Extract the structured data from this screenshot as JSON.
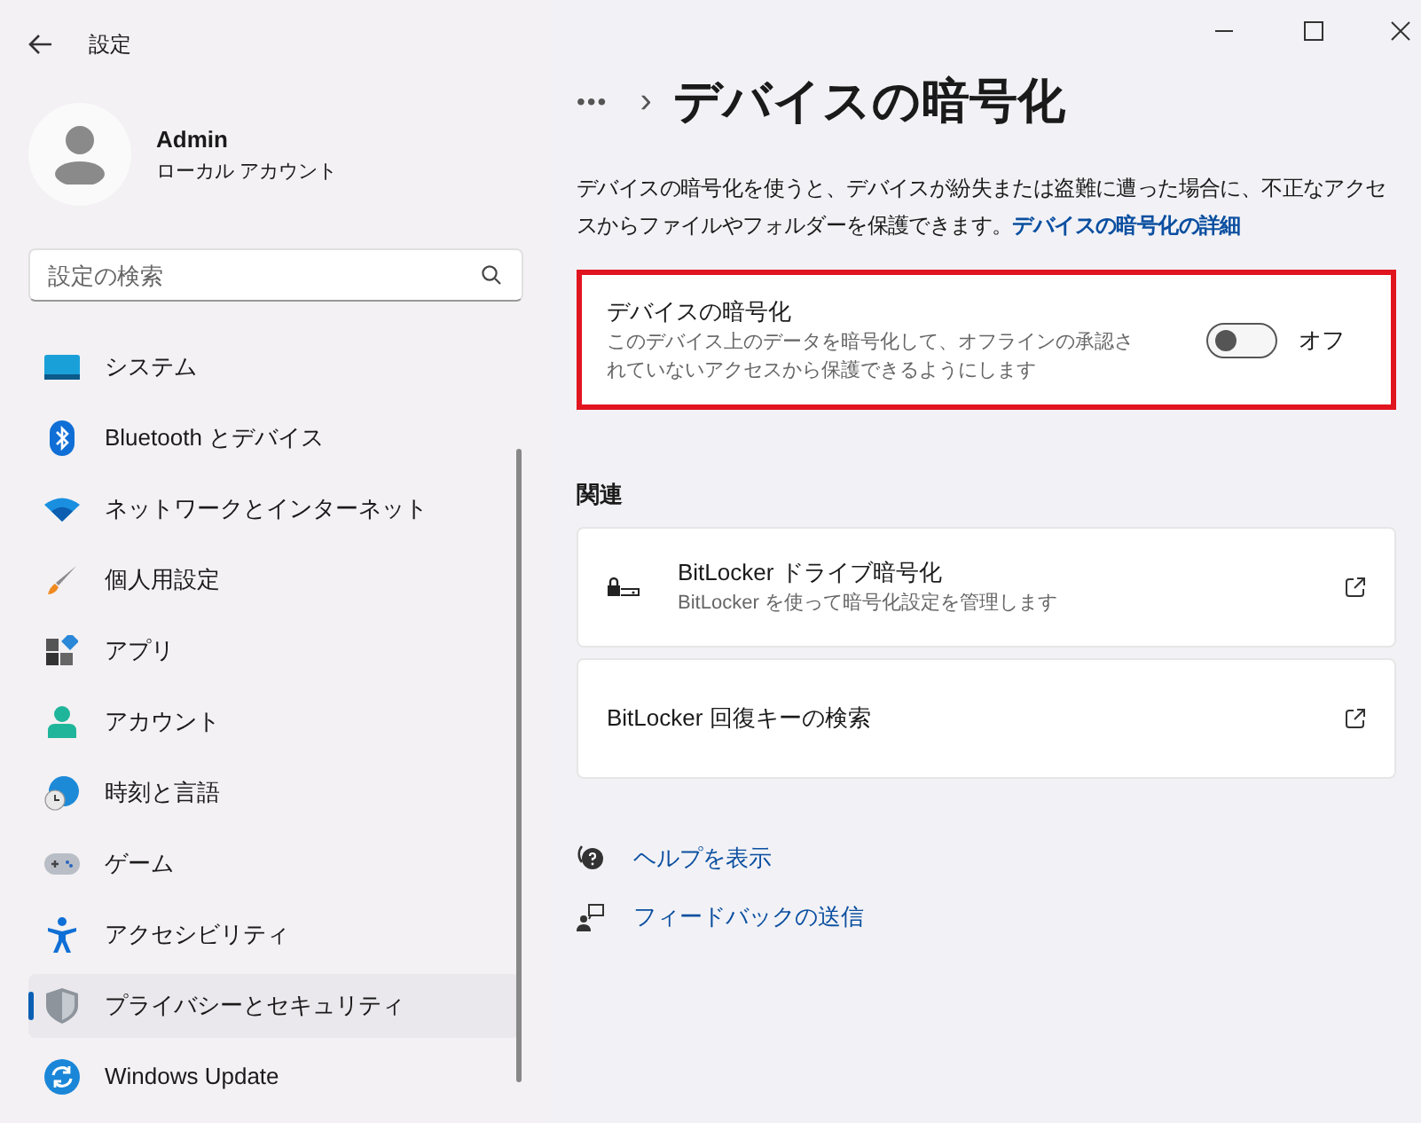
{
  "window": {
    "title": "設定"
  },
  "account": {
    "name": "Admin",
    "type": "ローカル アカウント"
  },
  "search": {
    "placeholder": "設定の検索"
  },
  "sidebar": {
    "items": [
      {
        "label": "システム",
        "selected": false
      },
      {
        "label": "Bluetooth とデバイス",
        "selected": false
      },
      {
        "label": "ネットワークとインターネット",
        "selected": false
      },
      {
        "label": "個人用設定",
        "selected": false
      },
      {
        "label": "アプリ",
        "selected": false
      },
      {
        "label": "アカウント",
        "selected": false
      },
      {
        "label": "時刻と言語",
        "selected": false
      },
      {
        "label": "ゲーム",
        "selected": false
      },
      {
        "label": "アクセシビリティ",
        "selected": false
      },
      {
        "label": "プライバシーとセキュリティ",
        "selected": true
      },
      {
        "label": "Windows Update",
        "selected": false
      }
    ]
  },
  "breadcrumb": {
    "ellipsis": "•••",
    "separator": "›",
    "title": "デバイスの暗号化"
  },
  "description": {
    "text": "デバイスの暗号化を使うと、デバイスが紛失または盗難に遭った場合に、不正なアクセスからファイルやフォルダーを保護できます。",
    "link": "デバイスの暗号化の詳細"
  },
  "encryption_card": {
    "title": "デバイスの暗号化",
    "subtitle": "このデバイス上のデータを暗号化して、オフラインの承認されていないアクセスから保護できるようにします",
    "on": false,
    "state_label": "オフ",
    "highlighted": true
  },
  "related": {
    "heading": "関連",
    "items": [
      {
        "kind": "icon",
        "title": "BitLocker ドライブ暗号化",
        "subtitle": "BitLocker を使って暗号化設定を管理します"
      },
      {
        "kind": "plain",
        "title": "BitLocker 回復キーの検索"
      }
    ]
  },
  "footer_links": [
    {
      "label": "ヘルプを表示"
    },
    {
      "label": "フィードバックの送信"
    }
  ]
}
